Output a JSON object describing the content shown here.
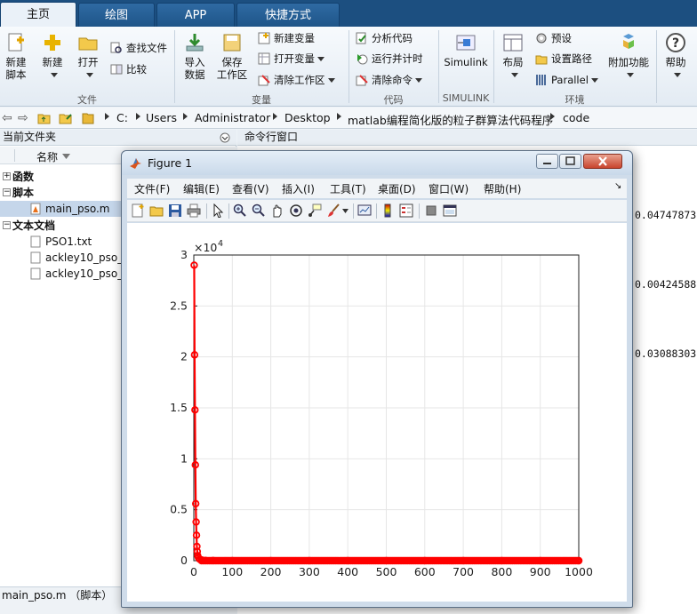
{
  "tabs": [
    "主页",
    "绘图",
    "APP",
    "快捷方式"
  ],
  "ribbon": {
    "new_script": "新建\n脚本",
    "new": "新建",
    "open": "打开",
    "find_files": "查找文件",
    "compare": "比较",
    "import_data": "导入\n数据",
    "save_workspace": "保存\n工作区",
    "new_variable": "新建变量",
    "open_variable": "打开变量",
    "clear_workspace": "清除工作区",
    "analyze_code": "分析代码",
    "run_and_time": "运行并计时",
    "clear_commands": "清除命令",
    "simulink": "Simulink",
    "layout": "布局",
    "preferences": "预设",
    "set_path": "设置路径",
    "parallel": "Parallel",
    "addons": "附加功能",
    "help": "帮助",
    "groups": {
      "file": "文件",
      "variable": "变量",
      "code": "代码",
      "simulink": "SIMULINK",
      "environment": "环境"
    }
  },
  "breadcrumbs": [
    "C:",
    "Users",
    "Administrator",
    "Desktop",
    "matlab编程简化版的粒子群算法代码程序",
    "code"
  ],
  "left_panel": {
    "title": "当前文件夹",
    "column_name": "名称",
    "group_functions": "函数",
    "group_scripts": "脚本",
    "file_main": "main_pso.m",
    "group_text": "文本文档",
    "file_pso1": "PSO1.txt",
    "file_ackley1": "ackley10_pso_",
    "file_ackley2": "ackley10_pso_",
    "status": "main_pso.m （脚本）"
  },
  "command_window": {
    "title": "命令行窗口",
    "values": [
      "0.04747873",
      "0.00424588",
      "0.03088303"
    ]
  },
  "figure": {
    "title": "Figure 1",
    "menu": [
      "文件(F)",
      "编辑(E)",
      "查看(V)",
      "插入(I)",
      "工具(T)",
      "桌面(D)",
      "窗口(W)",
      "帮助(H)"
    ],
    "toolbar_icons": [
      "new-figure-icon",
      "open-icon",
      "save-icon",
      "print-icon",
      "pointer-icon",
      "zoom-in-icon",
      "zoom-out-icon",
      "pan-icon",
      "rotate-icon",
      "data-cursor-icon",
      "brush-icon",
      "link-icon",
      "colorbar-icon",
      "legend-icon",
      "hide-plot-tools-icon",
      "show-plot-tools-icon"
    ]
  },
  "colors": {
    "series": "#ff0000",
    "ribbon_tab": "#1c4f80"
  },
  "chart_data": {
    "type": "line",
    "title": "",
    "xlabel": "",
    "ylabel": "",
    "y_exponent_label": "×10",
    "y_exponent": "4",
    "xlim": [
      0,
      1000
    ],
    "ylim": [
      0,
      30000
    ],
    "xticks": [
      0,
      100,
      200,
      300,
      400,
      500,
      600,
      700,
      800,
      900,
      1000
    ],
    "yticks": [
      0,
      5000,
      10000,
      15000,
      20000,
      25000,
      30000
    ],
    "ytick_labels": [
      "0",
      "0.5",
      "1",
      "1.5",
      "2",
      "2.5",
      "3"
    ],
    "grid": true,
    "marker": "circle",
    "series": [
      {
        "x": [
          1,
          2,
          3,
          4,
          5,
          6,
          7,
          8,
          9,
          10,
          12,
          15,
          20,
          30,
          50,
          100,
          200,
          300,
          400,
          500,
          600,
          700,
          800,
          900,
          1000
        ],
        "y": [
          29000,
          20200,
          14800,
          9400,
          5600,
          3800,
          2500,
          1400,
          900,
          500,
          300,
          150,
          80,
          30,
          10,
          2,
          0.5,
          0.2,
          0.1,
          0.05,
          0.05,
          0.05,
          0.05,
          0.05,
          0.05
        ]
      }
    ]
  }
}
